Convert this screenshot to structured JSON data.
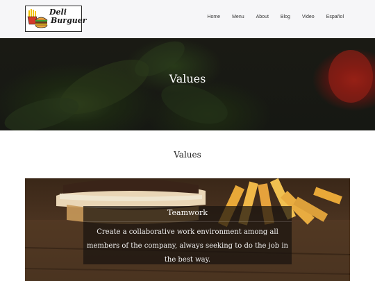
{
  "header": {
    "logo_line1": "Deli",
    "logo_line2": "Burguer",
    "nav": [
      "Home",
      "Menu",
      "About",
      "Blog",
      "Video",
      "Español"
    ]
  },
  "hero": {
    "title": "Values"
  },
  "section": {
    "title": "Values"
  },
  "card": {
    "title": "Teamwork",
    "text": "Create a collaborative work environment among all members of the company, always seeking to do the job in the best way."
  },
  "colors": {
    "header_bg": "#f6f6f8",
    "hero_text": "#ffffff",
    "overlay": "#19140f"
  },
  "icons": [
    "fries-icon",
    "burger-icon"
  ]
}
